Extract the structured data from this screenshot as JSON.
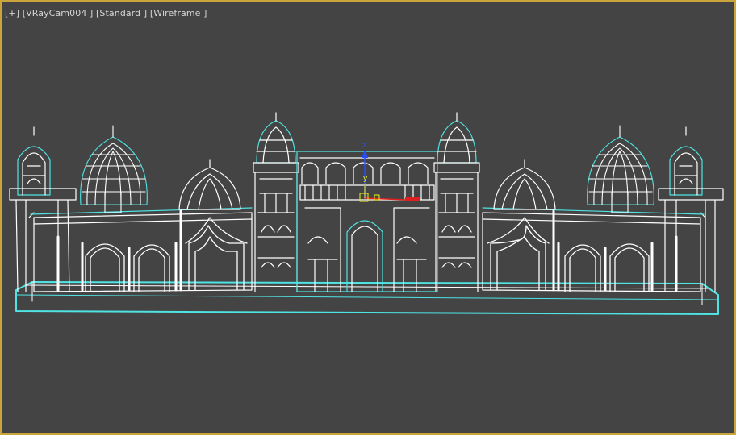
{
  "viewport": {
    "label_plus": "[+]",
    "label_camera": "[VRayCam004 ]",
    "label_shading": "[Standard ]",
    "label_mode": "[Wireframe ]",
    "active_border_color": "#c9a53c",
    "background_color": "#444444"
  },
  "scene": {
    "wire_color": "#ffffff",
    "selection_color": "#4fe3e3"
  },
  "gizmo": {
    "axis_z": "z",
    "axis_y": "y",
    "z_color": "#2a4cff",
    "y_color": "#f0f020",
    "x_color": "#e02020"
  }
}
